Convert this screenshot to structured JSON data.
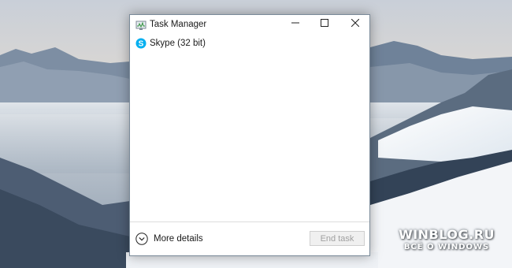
{
  "window": {
    "title": "Task Manager",
    "icon": "task-manager-icon"
  },
  "controls": {
    "minimize_icon": "minimize-icon",
    "maximize_icon": "maximize-icon",
    "close_icon": "close-icon"
  },
  "processes": [
    {
      "name": "Skype (32 bit)",
      "icon": "skype-icon"
    }
  ],
  "footer": {
    "more_details_label": "More details",
    "end_task_label": "End task"
  },
  "watermark": {
    "main": "WINBLOG.RU",
    "sub": "ВСЁ О WINDOWS"
  },
  "colors": {
    "skype_blue": "#00aff0",
    "disabled_text": "#a0a0a0"
  }
}
